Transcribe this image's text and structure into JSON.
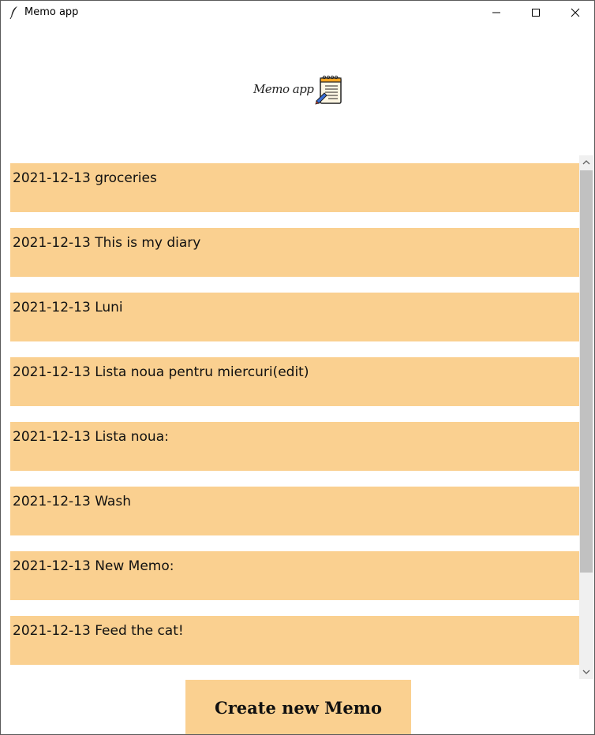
{
  "window": {
    "title": "Memo app",
    "icons": {
      "app": "feather-icon",
      "minimize": "minimize-icon",
      "maximize": "maximize-icon",
      "close": "close-icon"
    }
  },
  "header": {
    "logo_text": "Memo app",
    "logo_icon": "notepad-icon"
  },
  "memos": [
    {
      "label": "2021-12-13 groceries"
    },
    {
      "label": "2021-12-13 This is my diary"
    },
    {
      "label": "2021-12-13 Luni"
    },
    {
      "label": "2021-12-13 Lista noua pentru miercuri(edit)"
    },
    {
      "label": "2021-12-13 Lista noua:"
    },
    {
      "label": "2021-12-13 Wash"
    },
    {
      "label": "2021-12-13 New Memo:"
    },
    {
      "label": "2021-12-13 Feed the cat!"
    }
  ],
  "actions": {
    "create_label": "Create new Memo"
  },
  "colors": {
    "memo_background": "#fad090",
    "button_background": "#fad090",
    "window_background": "#ffffff"
  }
}
